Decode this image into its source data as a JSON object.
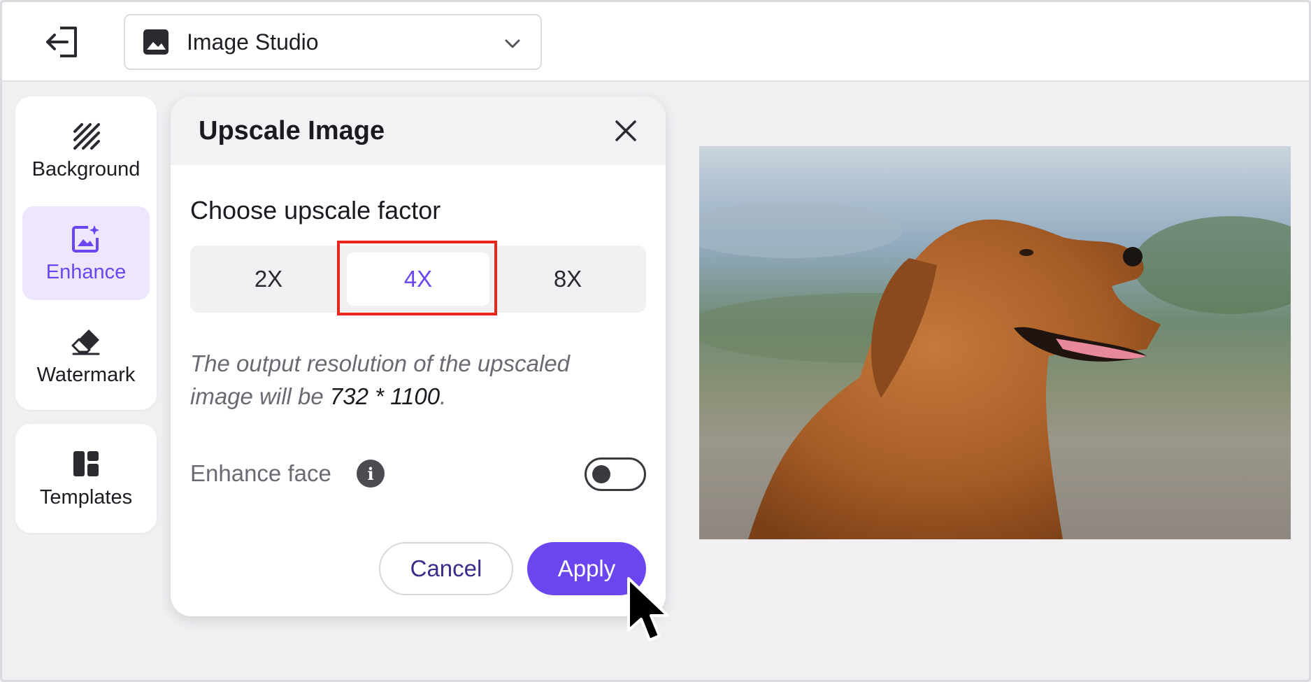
{
  "topbar": {
    "exit_icon": "exit-icon",
    "studio_select": {
      "icon": "image-icon",
      "value": "Image Studio",
      "chevron": "chevron-down-icon"
    }
  },
  "sidebar": {
    "items": [
      {
        "label": "Background",
        "icon": "background-icon",
        "active": false
      },
      {
        "label": "Enhance",
        "icon": "enhance-icon",
        "active": true
      },
      {
        "label": "Watermark",
        "icon": "eraser-icon",
        "active": false
      }
    ],
    "templates": {
      "label": "Templates",
      "icon": "templates-icon"
    }
  },
  "panel": {
    "title": "Upscale Image",
    "section_label": "Choose upscale factor",
    "factors": [
      "2X",
      "4X",
      "8X"
    ],
    "selected_factor": "4X",
    "description_prefix": "The output resolution of the upscaled image will be ",
    "resolution": "732 * 1100",
    "description_suffix": ".",
    "enhance_face_label": "Enhance face",
    "enhance_face_on": false,
    "cancel_label": "Cancel",
    "apply_label": "Apply"
  },
  "colors": {
    "accent": "#6a45f0",
    "active_bg": "#ede6fd",
    "highlight": "#e8261c"
  },
  "preview": {
    "icon": "dog-photo"
  }
}
